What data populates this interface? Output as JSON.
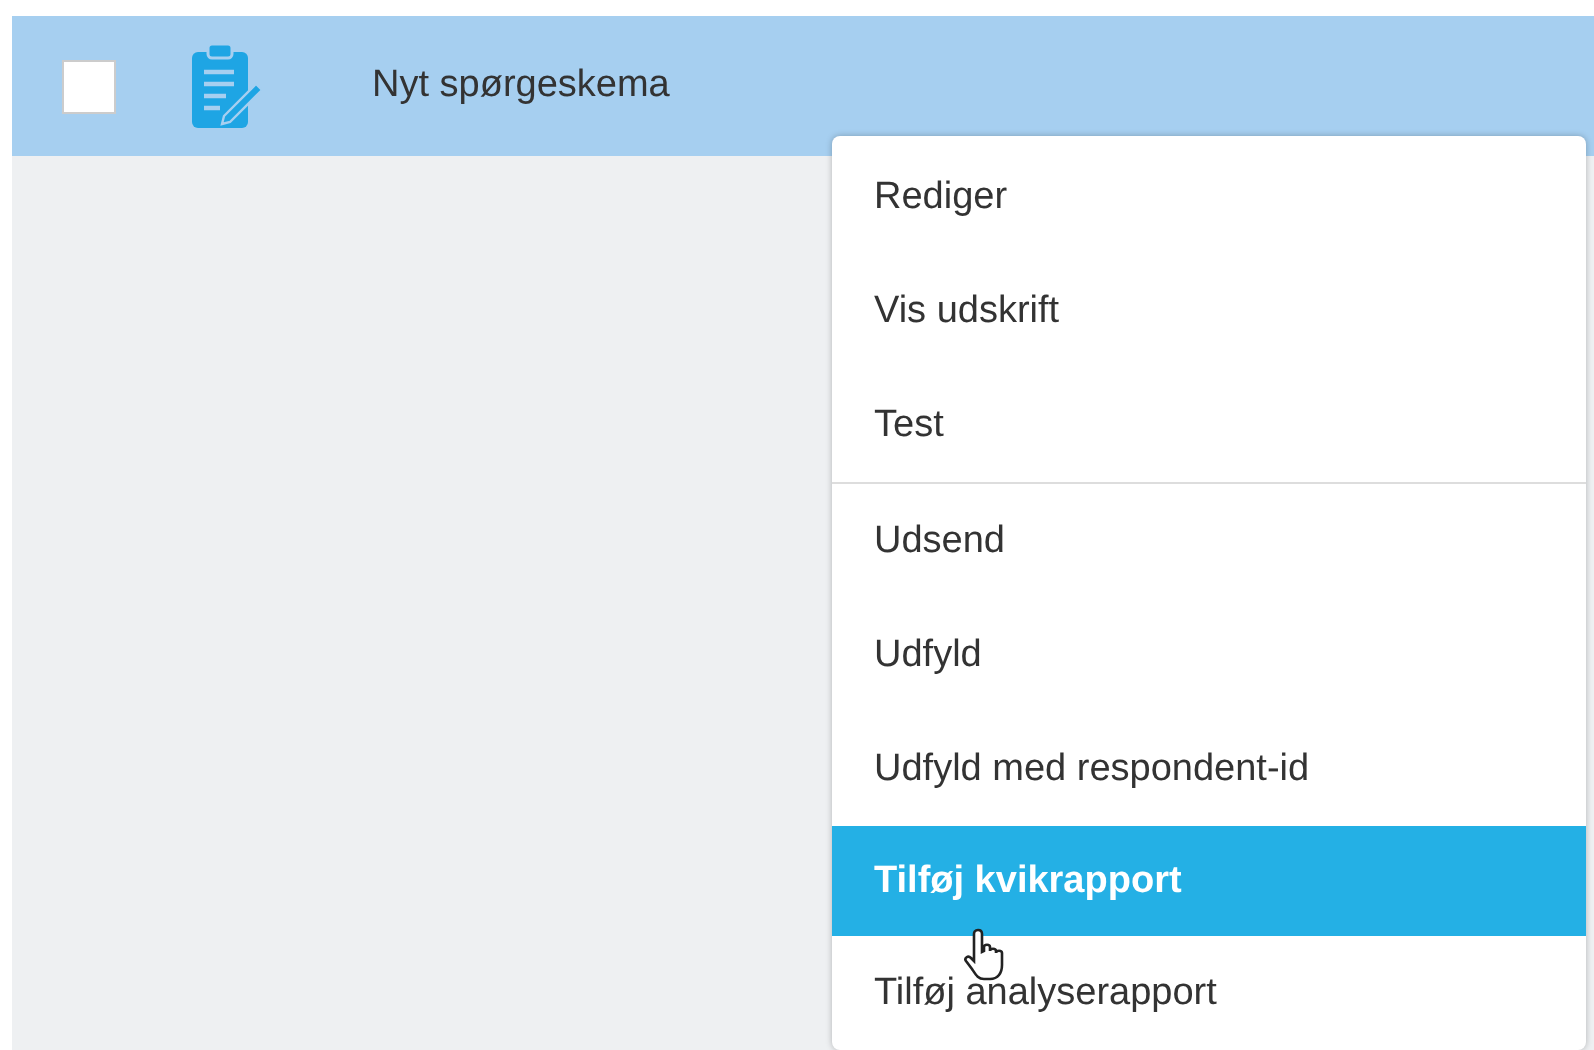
{
  "row": {
    "checked": false,
    "title": "Nyt spørgeskema"
  },
  "menu": {
    "groups": [
      [
        {
          "label": "Rediger",
          "selected": false
        },
        {
          "label": "Vis udskrift",
          "selected": false
        },
        {
          "label": "Test",
          "selected": false
        }
      ],
      [
        {
          "label": "Udsend",
          "selected": false
        },
        {
          "label": "Udfyld",
          "selected": false
        },
        {
          "label": "Udfyld med respondent-id",
          "selected": false
        },
        {
          "label": "Tilføj kvikrapport",
          "selected": true
        },
        {
          "label": "Tilføj analyserapport",
          "selected": false
        }
      ]
    ]
  }
}
